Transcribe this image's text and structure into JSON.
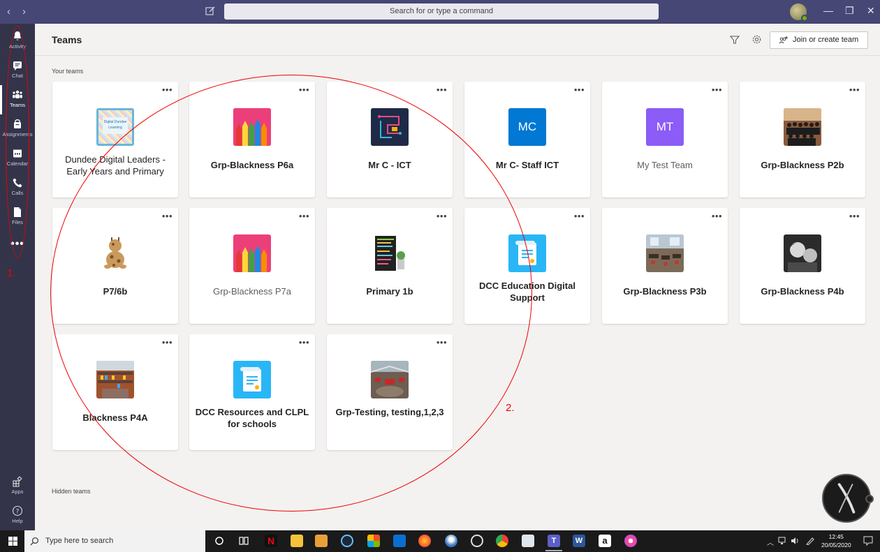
{
  "titlebar": {
    "back": "‹",
    "forward": "›",
    "search_placeholder": "Search for or type a command",
    "minimize": "—",
    "maximize": "❐",
    "close": "✕"
  },
  "rail": {
    "items": [
      {
        "label": "Activity",
        "icon": "bell-icon"
      },
      {
        "label": "Chat",
        "icon": "chat-icon"
      },
      {
        "label": "Teams",
        "icon": "teams-icon"
      },
      {
        "label": "Assignments",
        "icon": "assignments-icon"
      },
      {
        "label": "Calendar",
        "icon": "calendar-icon"
      },
      {
        "label": "Calls",
        "icon": "phone-icon"
      },
      {
        "label": "Files",
        "icon": "file-icon"
      }
    ],
    "more": "•••",
    "apps_label": "Apps",
    "help_label": "Help"
  },
  "annotations": {
    "one": "1.",
    "two": "2."
  },
  "header": {
    "title": "Teams",
    "join_label": "Join or create team"
  },
  "sections": {
    "your_teams": "Your teams",
    "hidden_teams": "Hidden teams"
  },
  "teams": [
    {
      "name": "Dundee Digital Leaders - Early Years and Primary",
      "bold": false
    },
    {
      "name": "Grp-Blackness P6a",
      "bold": true
    },
    {
      "name": "Mr C - ICT",
      "bold": true
    },
    {
      "name": "Mr C- Staff ICT",
      "bold": true,
      "initials": "MC"
    },
    {
      "name": "My Test Team",
      "bold": false,
      "initials": "MT"
    },
    {
      "name": "Grp-Blackness P2b",
      "bold": true
    },
    {
      "name": "P7/6b",
      "bold": true
    },
    {
      "name": "Grp-Blackness P7a",
      "bold": false
    },
    {
      "name": "Primary 1b",
      "bold": true
    },
    {
      "name": "DCC Education Digital Support",
      "bold": true
    },
    {
      "name": "Grp-Blackness P3b",
      "bold": true
    },
    {
      "name": "Grp-Blackness P4b",
      "bold": true
    },
    {
      "name": "Blackness P4A",
      "bold": true
    },
    {
      "name": "DCC Resources and CLPL for schools",
      "bold": true
    },
    {
      "name": "Grp-Testing, testing,1,2,3",
      "bold": true
    }
  ],
  "card_more": "•••",
  "thumb_text": {
    "ddl": "Digital Dundee Learning"
  },
  "taskbar": {
    "search_placeholder": "Type here to search",
    "time": "12:45",
    "date": "20/05/2020"
  },
  "colors": {
    "titlebar": "#464775",
    "rail": "#33344a",
    "mc_tile": "#0078d4",
    "mt_tile": "#8b5cf6",
    "annotation": "#ee0000"
  }
}
